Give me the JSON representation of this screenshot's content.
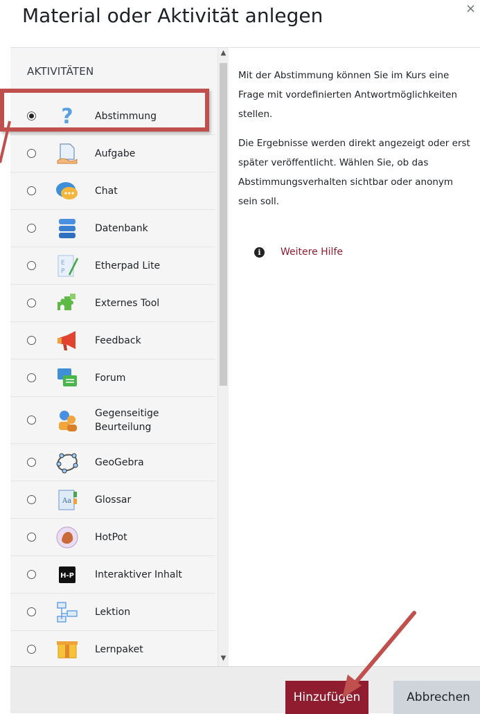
{
  "dialog": {
    "title": "Material oder Aktivität anlegen",
    "close_symbol": "×"
  },
  "activities": {
    "section_heading": "AKTIVITÄTEN",
    "items": [
      {
        "label": "Abstimmung",
        "icon": "question-mark-icon",
        "selected": true
      },
      {
        "label": "Aufgabe",
        "icon": "assignment-icon",
        "selected": false
      },
      {
        "label": "Chat",
        "icon": "chat-bubbles-icon",
        "selected": false
      },
      {
        "label": "Datenbank",
        "icon": "database-icon",
        "selected": false
      },
      {
        "label": "Etherpad Lite",
        "icon": "etherpad-icon",
        "selected": false
      },
      {
        "label": "Externes Tool",
        "icon": "puzzle-icon",
        "selected": false
      },
      {
        "label": "Feedback",
        "icon": "megaphone-icon",
        "selected": false
      },
      {
        "label": "Forum",
        "icon": "forum-icon",
        "selected": false
      },
      {
        "label": "Gegenseitige Beurteilung",
        "icon": "workshop-icon",
        "selected": false
      },
      {
        "label": "GeoGebra",
        "icon": "geogebra-icon",
        "selected": false
      },
      {
        "label": "Glossar",
        "icon": "glossary-icon",
        "selected": false
      },
      {
        "label": "HotPot",
        "icon": "hotpot-icon",
        "selected": false
      },
      {
        "label": "Interaktiver Inhalt",
        "icon": "h5p-icon",
        "selected": false
      },
      {
        "label": "Lektion",
        "icon": "lesson-icon",
        "selected": false
      },
      {
        "label": "Lernpaket",
        "icon": "package-icon",
        "selected": false
      }
    ]
  },
  "description": {
    "paragraph1": "Mit der Abstimmung können Sie im Kurs eine Frage mit vordefinierten Antwortmöglichkeiten stellen.",
    "paragraph2": "Die Ergebnisse werden direkt angezeigt oder erst später veröffentlicht. Wählen Sie, ob das Abstimmungsverhalten sichtbar oder anonym sein soll.",
    "help_link": "Weitere Hilfe",
    "help_icon": "info-icon"
  },
  "footer": {
    "add_label": "Hinzufügen",
    "cancel_label": "Abbrechen"
  },
  "colors": {
    "primary": "#8f1d2f",
    "highlight": "#c0504d",
    "secondary_button": "#ced4da"
  }
}
